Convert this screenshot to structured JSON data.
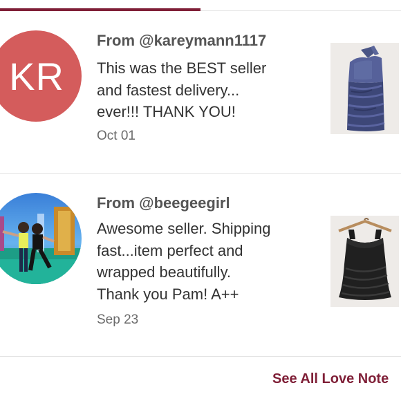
{
  "colors": {
    "accent": "#7f1f37",
    "avatar_initials_bg": "#d45c5c",
    "divider": "#e3e3e3"
  },
  "love_notes": [
    {
      "avatar": {
        "type": "initials",
        "initials": "KR"
      },
      "from": "From @kareymann1117",
      "message_lines": [
        "This was the BEST seller",
        "and fastest delivery...",
        "ever!!! THANK YOU!"
      ],
      "date": "Oct 01",
      "item_image": "navy-ruched-dress-thumbnail"
    },
    {
      "avatar": {
        "type": "photo",
        "description": "user-profile-photo"
      },
      "from": "From @beegeegirl",
      "message_lines": [
        "Awesome seller. Shipping",
        "fast...item perfect and",
        "wrapped beautifully.",
        "Thank you Pam! A++"
      ],
      "date": "Sep 23",
      "item_image": "black-ruched-top-thumbnail"
    }
  ],
  "see_all_label": "See All Love Note"
}
